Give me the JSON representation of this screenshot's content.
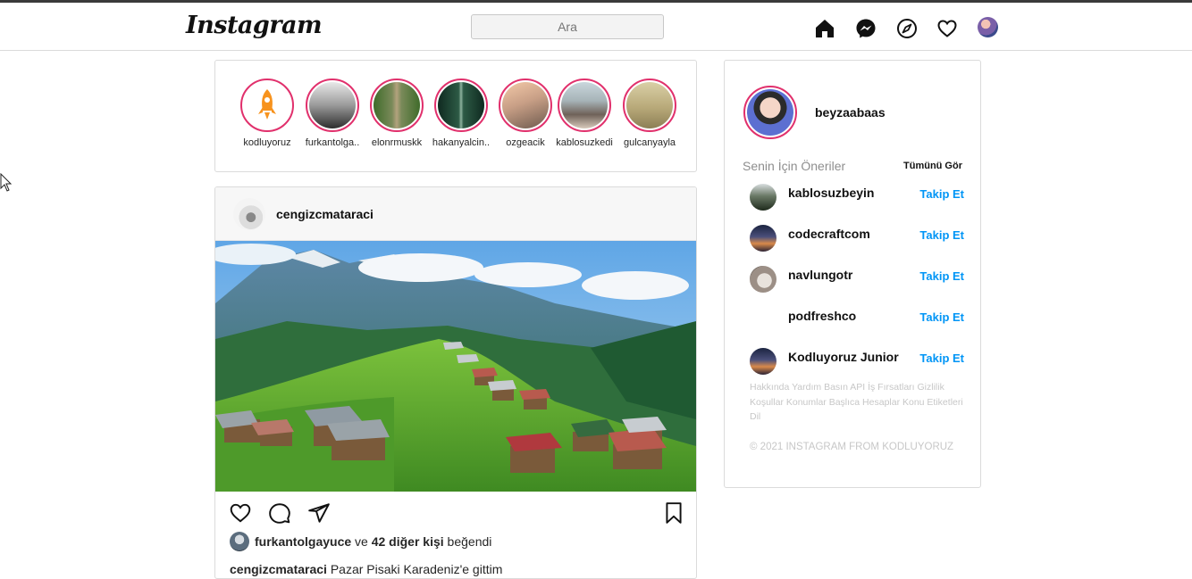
{
  "header": {
    "logo": "Instagram",
    "search_placeholder": "Ara",
    "icons": [
      "home-icon",
      "messenger-icon",
      "explore-icon",
      "heart-icon",
      "profile-avatar"
    ]
  },
  "stories": [
    {
      "username": "kodluyoruz"
    },
    {
      "username": "furkantolga.."
    },
    {
      "username": "elonrmuskk"
    },
    {
      "username": "hakanyalcin.."
    },
    {
      "username": "ozgeacik"
    },
    {
      "username": "kablosuzkedi"
    },
    {
      "username": "gulcanyayla"
    }
  ],
  "post": {
    "username": "cengizcmataraci",
    "liked_by_user": "furkantolgayuce",
    "liked_connector": "ve",
    "liked_others": "42 diğer kişi",
    "liked_suffix": "beğendi",
    "caption_user": "cengizcmataraci",
    "caption_text": "Pazar Pisaki Karadeniz'e gittim"
  },
  "sidebar": {
    "username": "beyzaabaas",
    "suggestions_title": "Senin İçin Öneriler",
    "see_all": "Tümünü Gör",
    "suggestions": [
      {
        "username": "kablosuzbeyin",
        "action": "Takip Et"
      },
      {
        "username": "codecraftcom",
        "action": "Takip Et"
      },
      {
        "username": "navlungotr",
        "action": "Takip Et"
      },
      {
        "username": "podfreshco",
        "action": "Takip Et"
      },
      {
        "username": "Kodluyoruz Junior",
        "action": "Takip Et"
      }
    ],
    "footer_links": "Hakkında Yardım Basın API İş Fırsatları Gizlilik Koşullar Konumlar Başlıca Hesaplar Konu Etiketleri Dil",
    "copyright": "© 2021 INSTAGRAM FROM KODLUYORUZ"
  },
  "colors": {
    "accent_blue": "#0095f6",
    "story_ring": "#e1306c",
    "border": "#dbdbdb"
  }
}
